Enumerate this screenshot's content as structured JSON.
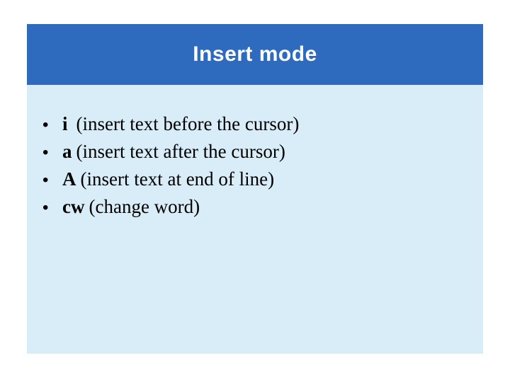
{
  "title": "Insert mode",
  "items": [
    {
      "cmd": "i",
      "desc": "(insert text before the cursor)",
      "wide": true
    },
    {
      "cmd": "a",
      "desc": "(insert text after the cursor)",
      "wide": false
    },
    {
      "cmd": "A",
      "desc": "(insert text at end of line)",
      "wide": false
    },
    {
      "cmd": "cw",
      "desc": "(change word)",
      "wide": false
    }
  ]
}
